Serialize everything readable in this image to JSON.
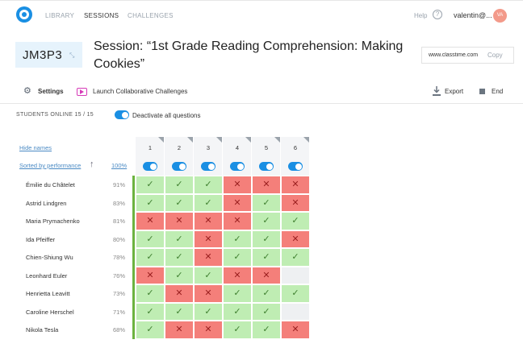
{
  "nav": {
    "library": "LIBRARY",
    "sessions": "SESSIONS",
    "challenges": "CHALLENGES",
    "help": "Help",
    "help_icon": "?",
    "user": "valentin@...",
    "avatar_initials": "VA"
  },
  "session": {
    "code": "JM3P3",
    "expand_icon": "⤡",
    "title": "Session: “1st Grade Reading Comprehension: Making Cookies”",
    "link": "www.classtime.com",
    "copy_label": "Copy"
  },
  "toolbar": {
    "settings": "Settings",
    "launch": "Launch Collaborative Challenges",
    "export": "Export",
    "end": "End"
  },
  "status": {
    "online": "STUDENTS ONLINE 15 / 15",
    "deactivate": "Deactivate all questions"
  },
  "table": {
    "hide_names": "Hide names",
    "sorted_by": "Sorted by performance",
    "sort_arrow": "↑",
    "overall_pct": "100%",
    "questions": [
      "1",
      "2",
      "3",
      "4",
      "5",
      "6"
    ],
    "rows": [
      {
        "name": "Émilie du Châtelet",
        "pct": "91%",
        "results": [
          "ok",
          "ok",
          "ok",
          "bad",
          "bad",
          "bad"
        ]
      },
      {
        "name": "Astrid Lindgren",
        "pct": "83%",
        "results": [
          "ok",
          "ok",
          "ok",
          "bad",
          "ok",
          "bad"
        ]
      },
      {
        "name": "Maria Prymachenko",
        "pct": "81%",
        "results": [
          "bad",
          "bad",
          "bad",
          "bad",
          "ok",
          "ok"
        ]
      },
      {
        "name": "Ida Pfeiffer",
        "pct": "80%",
        "results": [
          "ok",
          "ok",
          "bad",
          "ok",
          "ok",
          "bad"
        ]
      },
      {
        "name": "Chien-Shiung Wu",
        "pct": "78%",
        "results": [
          "ok",
          "ok",
          "bad",
          "ok",
          "ok",
          "ok"
        ]
      },
      {
        "name": "Leonhard Euler",
        "pct": "76%",
        "results": [
          "bad",
          "ok",
          "ok",
          "bad",
          "bad",
          "none"
        ]
      },
      {
        "name": "Henrietta Leavitt",
        "pct": "73%",
        "results": [
          "ok",
          "bad",
          "bad",
          "ok",
          "ok",
          "ok"
        ]
      },
      {
        "name": "Caroline Herschel",
        "pct": "71%",
        "results": [
          "ok",
          "ok",
          "ok",
          "ok",
          "ok",
          "none"
        ]
      },
      {
        "name": "Nikola Tesla",
        "pct": "68%",
        "results": [
          "ok",
          "bad",
          "bad",
          "ok",
          "ok",
          "bad"
        ]
      }
    ],
    "check_glyph": "✓",
    "cross_glyph": "✕"
  },
  "colors": {
    "accent": "#1a8fe3",
    "correct": "#bfedb3",
    "wrong": "#f47f7a",
    "empty": "#eef0f2"
  }
}
